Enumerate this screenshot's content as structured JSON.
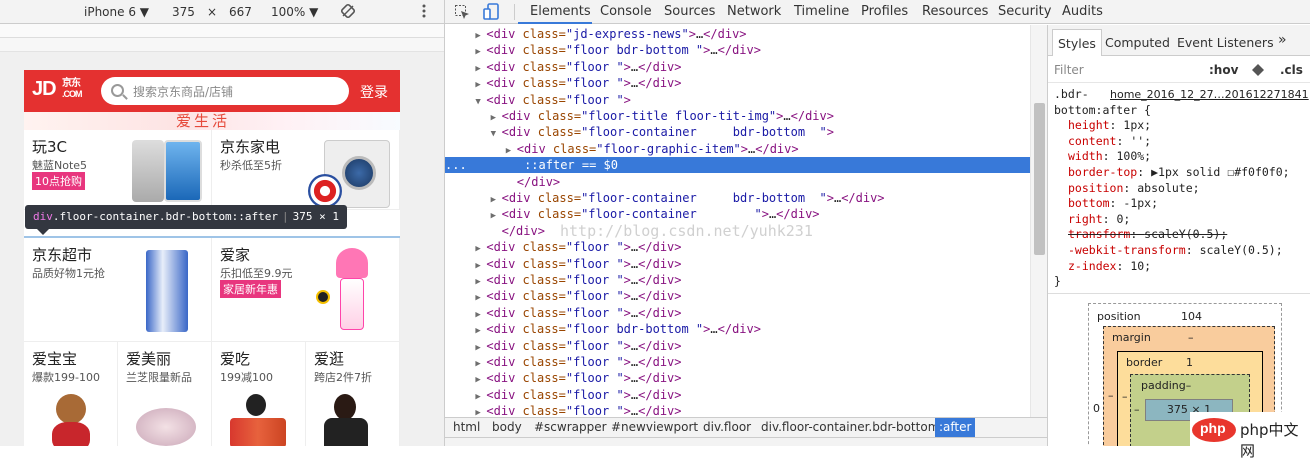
{
  "device_bar": {
    "device": "iPhone 6",
    "width": "375",
    "times": "×",
    "height": "667",
    "zoom": "100%"
  },
  "jd": {
    "logo": "JD",
    "logo_cn": "京东",
    "logo_com": ".COM",
    "search_placeholder": "搜索京东商品/店铺",
    "login": "登录",
    "banner": "爱生活",
    "cells": [
      {
        "title": "玩3C",
        "sub": "魅蓝Note5",
        "tag": "10点抢购"
      },
      {
        "title": "京东家电",
        "sub": "秒杀低至5折",
        "tag": ""
      },
      {
        "title": "京东超市",
        "sub": "品质好物1元抢",
        "tag": ""
      },
      {
        "title": "爱家",
        "sub": "乐扣低至9.9元",
        "tag": "家居新年惠"
      },
      {
        "title": "爱宝宝",
        "sub": "爆款199-100",
        "tag": ""
      },
      {
        "title": "爱美丽",
        "sub": "兰芝限量新品",
        "tag": ""
      },
      {
        "title": "爱吃",
        "sub": "199减100",
        "tag": ""
      },
      {
        "title": "爱逛",
        "sub": "跨店2件7折",
        "tag": ""
      }
    ]
  },
  "tooltip": {
    "tag": "div",
    "classes": ".floor-container.bdr-bottom::after",
    "size": "375 × 1"
  },
  "devtools": {
    "tabs": [
      "Elements",
      "Console",
      "Sources",
      "Network",
      "Timeline",
      "Profiles",
      "Resources",
      "Security",
      "Audits"
    ],
    "rows": [
      {
        "i": 4,
        "arrow": "▶",
        "html": "<div class=\"jd-express-news\">…</div>"
      },
      {
        "i": 4,
        "arrow": "▶",
        "html": "<div class=\"floor bdr-bottom \">…</div>"
      },
      {
        "i": 4,
        "arrow": "▶",
        "html": "<div class=\"floor \">…</div>"
      },
      {
        "i": 4,
        "arrow": "▶",
        "html": "<div class=\"floor \">…</div>"
      },
      {
        "i": 4,
        "arrow": "▼",
        "html": "<div class=\"floor \">"
      },
      {
        "i": 6,
        "arrow": "▶",
        "html": "<div class=\"floor-title floor-tit-img\">…</div>"
      },
      {
        "i": 6,
        "arrow": "▼",
        "html": "<div class=\"floor-container     bdr-bottom  \">"
      },
      {
        "i": 8,
        "arrow": "▶",
        "html": "<div class=\"floor-graphic-item\">…</div>"
      },
      {
        "i": 9,
        "arrow": "",
        "html": "::after == $0",
        "sel": true
      },
      {
        "i": 8,
        "arrow": "",
        "html": "</div>"
      },
      {
        "i": 6,
        "arrow": "▶",
        "html": "<div class=\"floor-container     bdr-bottom  \">…</div>"
      },
      {
        "i": 6,
        "arrow": "▶",
        "html": "<div class=\"floor-container        \">…</div>"
      },
      {
        "i": 6,
        "arrow": "",
        "html": "</div>"
      },
      {
        "i": 4,
        "arrow": "▶",
        "html": "<div class=\"floor \">…</div>"
      },
      {
        "i": 4,
        "arrow": "▶",
        "html": "<div class=\"floor \">…</div>"
      },
      {
        "i": 4,
        "arrow": "▶",
        "html": "<div class=\"floor \">…</div>"
      },
      {
        "i": 4,
        "arrow": "▶",
        "html": "<div class=\"floor \">…</div>"
      },
      {
        "i": 4,
        "arrow": "▶",
        "html": "<div class=\"floor \">…</div>"
      },
      {
        "i": 4,
        "arrow": "▶",
        "html": "<div class=\"floor bdr-bottom \">…</div>"
      },
      {
        "i": 4,
        "arrow": "▶",
        "html": "<div class=\"floor \">…</div>"
      },
      {
        "i": 4,
        "arrow": "▶",
        "html": "<div class=\"floor \">…</div>"
      },
      {
        "i": 4,
        "arrow": "▶",
        "html": "<div class=\"floor \">…</div>"
      },
      {
        "i": 4,
        "arrow": "▶",
        "html": "<div class=\"floor \">…</div>"
      },
      {
        "i": 4,
        "arrow": "▶",
        "html": "<div class=\"floor \">…</div>"
      }
    ],
    "watermark": "http://blog.csdn.net/yuhk231",
    "breadcrumbs": [
      "html",
      "body",
      "#scwrapper",
      "#newviewport",
      "div.floor",
      "div.floor-container.bdr-bottom",
      ":after"
    ]
  },
  "styles": {
    "tabs": [
      "Styles",
      "Computed",
      "Event Listeners"
    ],
    "more": "»",
    "filter": "Filter",
    "hov": ":hov",
    "cls": ".cls",
    "selector_line1": ".bdr-",
    "source": "home_2016_12_27…201612271841",
    "selector_line2": "bottom:after {",
    "props": [
      {
        "name": "height",
        "value": "1px;",
        "strike": false
      },
      {
        "name": "content",
        "value": "'';",
        "strike": false
      },
      {
        "name": "width",
        "value": "100%;",
        "strike": false
      },
      {
        "name": "border-top",
        "value": "▶1px solid ☐#f0f0f0;",
        "strike": false
      },
      {
        "name": "position",
        "value": "absolute;",
        "strike": false
      },
      {
        "name": "bottom",
        "value": "-1px;",
        "strike": false
      },
      {
        "name": "right",
        "value": "0;",
        "strike": false
      },
      {
        "name": "transform",
        "value": "scaleY(0.5);",
        "strike": true
      },
      {
        "name": "-webkit-transform",
        "value": "scaleY(0.5);",
        "strike": false
      },
      {
        "name": "z-index",
        "value": "10;",
        "strike": false
      }
    ],
    "close": "}",
    "box": {
      "position_label": "position",
      "position_val": "104",
      "margin_label": "margin",
      "margin_val": "–",
      "border_label": "border",
      "border_val": "1",
      "padding_label": "padding–",
      "content": "375 × 1",
      "left0": "0",
      "right0": "0",
      "dash": "–"
    }
  },
  "watermark_site": "php中文网"
}
